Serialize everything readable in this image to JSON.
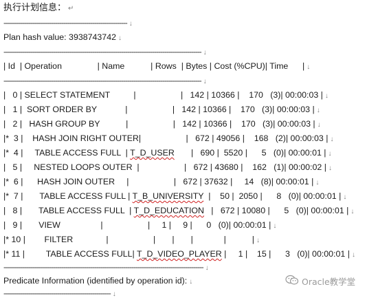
{
  "title": "执行计划信息：",
  "return_mark": "↵",
  "down_mark": "↓",
  "separators": {
    "short": "------------------------------------------------------------",
    "long": "------------------------------------------------------------------------------------------------",
    "bottom": "-------------------------------------------------------------------------------------------------",
    "last": "----------------------------------------------------"
  },
  "plan_hash": "Plan hash value: 3938743742",
  "header": "| Id  | Operation               | Name           | Rows  | Bytes | Cost (%CPU)| Time      |",
  "rows": [
    {
      "pre": "|   0 | SELECT STATEMENT          |                   |   142 | 10366 |    170   (3)| 00:00:03 |",
      "name": "",
      "post": ""
    },
    {
      "pre": "|   1 |  SORT ORDER BY            |                   |   142 | 10366 |    170   (3)| 00:00:03 |",
      "name": "",
      "post": ""
    },
    {
      "pre": "|   2 |   HASH GROUP BY           |                   |   142 | 10366 |    170   (3)| 00:00:03 |",
      "name": "",
      "post": ""
    },
    {
      "pre": "|*  3 |    HASH JOIN RIGHT OUTER|                   |   672 | 49056 |    168   (2)| 00:00:03 |",
      "name": "",
      "post": ""
    },
    {
      "pre": "|*  4 |     TABLE ACCESS FULL  | ",
      "name": "T_D_USER",
      "post": "       |   690 |  5520 |      5   (0)| 00:00:01 |"
    },
    {
      "pre": "|   5 |     NESTED LOOPS OUTER  |                   |   672 | 43680 |    162   (1)| 00:00:02 |",
      "name": "",
      "post": ""
    },
    {
      "pre": "|*  6 |      HASH JOIN OUTER     |                   |   672 | 37632 |     14   (8)| 00:00:01 |",
      "name": "",
      "post": ""
    },
    {
      "pre": "|*  7 |       TABLE ACCESS FULL | ",
      "name": "T_B_UNIVERSITY",
      "post": "  |    50 |  2050 |      8   (0)| 00:00:01 |"
    },
    {
      "pre": "|   8 |       TABLE ACCESS FULL  | ",
      "name": "T_D_EDUCATION",
      "post": "   |   672 | 10080 |      5   (0)| 00:00:01 |"
    },
    {
      "pre": "|   9 |       VIEW                 |                   |     1 |     9 |      0   (0)| 00:00:01 |",
      "name": "",
      "post": ""
    },
    {
      "pre": "|* 10 |        FILTER              |                   |       |       |             |           |",
      "name": "",
      "post": ""
    },
    {
      "pre": "|* 11 |         TABLE ACCESS FULL| ",
      "name": "T_D_VIDEO_PLAYER",
      "post": " |     1 |    15 |      3   (0)| 00:00:01 |"
    }
  ],
  "predicate": "Predicate Information (identified by operation id):",
  "watermark": "Oracle教学堂"
}
